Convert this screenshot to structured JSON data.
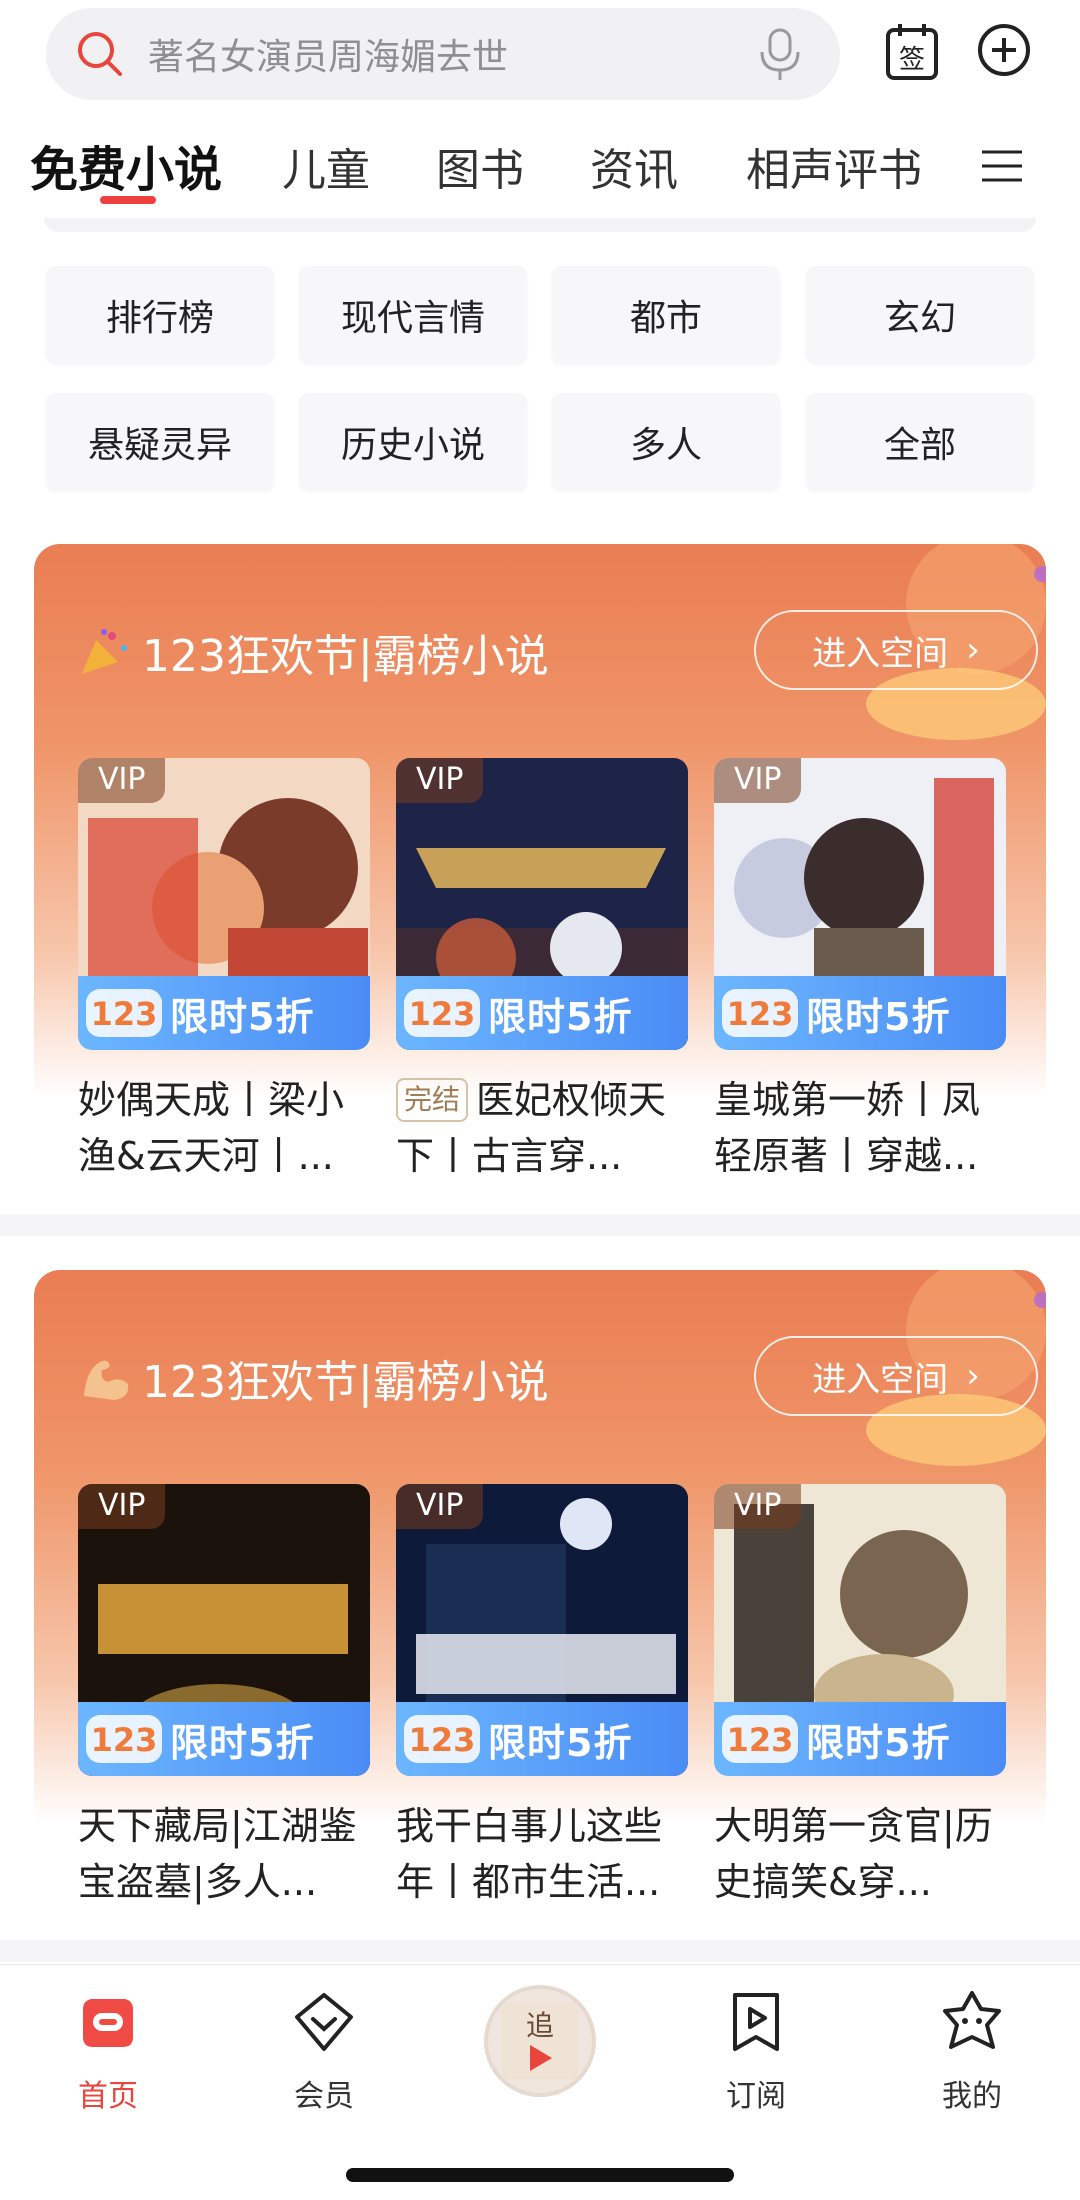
{
  "search": {
    "placeholder_text": "著名女演员周海媚去世"
  },
  "tabs": [
    "免费小说",
    "儿童",
    "图书",
    "资讯",
    "相声评书"
  ],
  "categories": [
    "排行榜",
    "现代言情",
    "都市",
    "玄幻",
    "悬疑灵异",
    "历史小说",
    "多人",
    "全部"
  ],
  "promo_sections": [
    {
      "title": "123狂欢节|霸榜小说",
      "enter_label": "进入空间",
      "books": [
        {
          "vip": "VIP",
          "promo": "限时5折",
          "completed": "",
          "title": "妙偶天成丨梁小渔&云天河丨..."
        },
        {
          "vip": "VIP",
          "promo": "限时5折",
          "completed": "完结",
          "title": "医妃权倾天下丨古言穿..."
        },
        {
          "vip": "VIP",
          "promo": "限时5折",
          "completed": "",
          "title": "皇城第一娇丨凤轻原著丨穿越..."
        }
      ]
    },
    {
      "title": "123狂欢节|霸榜小说",
      "enter_label": "进入空间",
      "books": [
        {
          "vip": "VIP",
          "promo": "限时5折",
          "completed": "",
          "title": "天下藏局|江湖鉴宝盗墓|多人..."
        },
        {
          "vip": "VIP",
          "promo": "限时5折",
          "completed": "",
          "title": "我干白事儿这些年丨都市生活..."
        },
        {
          "vip": "VIP",
          "promo": "限时5折",
          "completed": "",
          "title": "大明第一贪官|历史搞笑&穿..."
        }
      ]
    }
  ],
  "bottom_nav": [
    {
      "label": "首页",
      "icon": "home-icon",
      "active": true
    },
    {
      "label": "会员",
      "icon": "vip-diamond-icon",
      "active": false
    },
    {
      "label": "订阅",
      "icon": "subscribe-icon",
      "active": false
    },
    {
      "label": "我的",
      "icon": "profile-icon",
      "active": false
    }
  ],
  "colors": {
    "accent": "#e8453c",
    "promo_orange": "#ea7d53",
    "promo_blue": "#4a8cf5"
  }
}
